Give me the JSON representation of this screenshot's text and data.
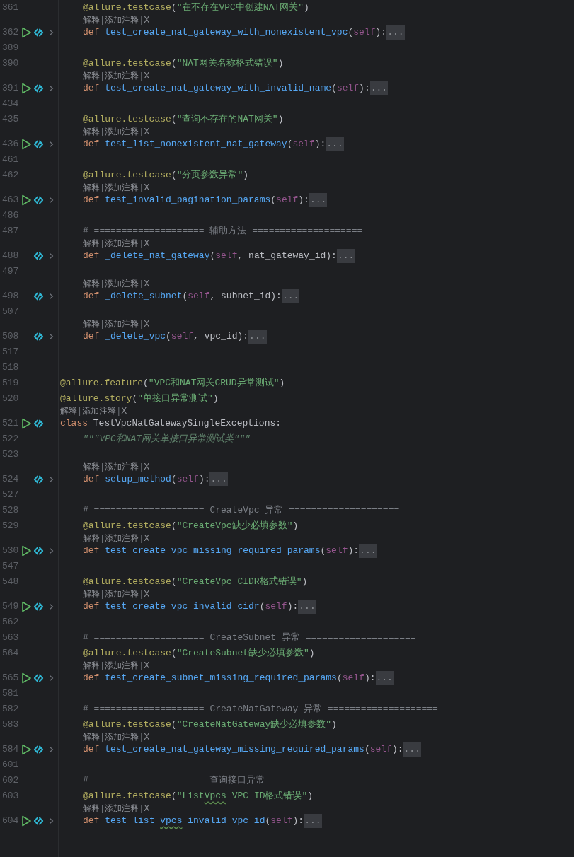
{
  "editor": {
    "lines": [
      {
        "kind": "group",
        "children": [
          {
            "kind": "code",
            "number": "361",
            "run": false,
            "link": false,
            "fold": false,
            "tokens": [
              {
                "kind": "dec",
                "s": "@allure.testcase"
              },
              {
                "kind": "plain",
                "s": "("
              },
              {
                "kind": "str",
                "s": "\"在不存在VPC中创建NAT网关\""
              },
              {
                "kind": "plain",
                "s": ")"
              }
            ]
          },
          {
            "kind": "hint",
            "links": [
              "解释",
              "添加注释",
              "X"
            ],
            "separator": "|"
          },
          {
            "kind": "code",
            "number": "362",
            "run": true,
            "link": true,
            "fold": true,
            "tokens": [
              {
                "kind": "kw",
                "s": "def "
              },
              {
                "kind": "fn",
                "s": "test_create_nat_gateway_with_nonexistent_vpc"
              },
              {
                "kind": "plain",
                "s": "("
              },
              {
                "kind": "self",
                "s": "self"
              },
              {
                "kind": "plain",
                "s": "):"
              }
            ],
            "folded": "..."
          },
          {
            "kind": "code",
            "number": "389",
            "run": false,
            "link": false,
            "fold": false
          },
          {
            "kind": "code",
            "number": "390",
            "run": false,
            "link": false,
            "fold": false,
            "tokens": [
              {
                "kind": "dec",
                "s": "@allure.testcase"
              },
              {
                "kind": "plain",
                "s": "("
              },
              {
                "kind": "str",
                "s": "\"NAT网关名称格式错误\""
              },
              {
                "kind": "plain",
                "s": ")"
              }
            ]
          },
          {
            "kind": "hint",
            "links": [
              "解释",
              "添加注释",
              "X"
            ],
            "separator": "|"
          },
          {
            "kind": "code",
            "number": "391",
            "run": true,
            "link": true,
            "fold": true,
            "tokens": [
              {
                "kind": "kw",
                "s": "def "
              },
              {
                "kind": "fn",
                "s": "test_create_nat_gateway_with_invalid_name"
              },
              {
                "kind": "plain",
                "s": "("
              },
              {
                "kind": "self",
                "s": "self"
              },
              {
                "kind": "plain",
                "s": "):"
              }
            ],
            "folded": "..."
          },
          {
            "kind": "code",
            "number": "434",
            "run": false,
            "link": false,
            "fold": false
          },
          {
            "kind": "code",
            "number": "435",
            "run": false,
            "link": false,
            "fold": false,
            "tokens": [
              {
                "kind": "dec",
                "s": "@allure.testcase"
              },
              {
                "kind": "plain",
                "s": "("
              },
              {
                "kind": "str",
                "s": "\"查询不存在的NAT网关\""
              },
              {
                "kind": "plain",
                "s": ")"
              }
            ]
          },
          {
            "kind": "hint",
            "links": [
              "解释",
              "添加注释",
              "X"
            ],
            "separator": "|"
          },
          {
            "kind": "code",
            "number": "436",
            "run": true,
            "link": true,
            "fold": true,
            "tokens": [
              {
                "kind": "kw",
                "s": "def "
              },
              {
                "kind": "fn",
                "s": "test_list_nonexistent_nat_gateway"
              },
              {
                "kind": "plain",
                "s": "("
              },
              {
                "kind": "self",
                "s": "self"
              },
              {
                "kind": "plain",
                "s": "):"
              }
            ],
            "folded": "..."
          },
          {
            "kind": "code",
            "number": "461",
            "run": false,
            "link": false,
            "fold": false
          },
          {
            "kind": "code",
            "number": "462",
            "run": false,
            "link": false,
            "fold": false,
            "tokens": [
              {
                "kind": "dec",
                "s": "@allure.testcase"
              },
              {
                "kind": "plain",
                "s": "("
              },
              {
                "kind": "str",
                "s": "\"分页参数异常\""
              },
              {
                "kind": "plain",
                "s": ")"
              }
            ]
          },
          {
            "kind": "hint",
            "links": [
              "解释",
              "添加注释",
              "X"
            ],
            "separator": "|"
          },
          {
            "kind": "code",
            "number": "463",
            "run": true,
            "link": true,
            "fold": true,
            "tokens": [
              {
                "kind": "kw",
                "s": "def "
              },
              {
                "kind": "fn",
                "s": "test_invalid_pagination_params"
              },
              {
                "kind": "plain",
                "s": "("
              },
              {
                "kind": "self",
                "s": "self"
              },
              {
                "kind": "plain",
                "s": "):"
              }
            ],
            "folded": "..."
          },
          {
            "kind": "code",
            "number": "486",
            "run": false,
            "link": false,
            "fold": false
          },
          {
            "kind": "code",
            "number": "487",
            "run": false,
            "link": false,
            "fold": false,
            "tokens": [
              {
                "kind": "comment",
                "s": "# ==================== 辅助方法 ===================="
              }
            ]
          },
          {
            "kind": "hint",
            "links": [
              "解释",
              "添加注释",
              "X"
            ],
            "separator": "|"
          },
          {
            "kind": "code",
            "number": "488",
            "run": false,
            "link": true,
            "fold": true,
            "tokens": [
              {
                "kind": "kw",
                "s": "def "
              },
              {
                "kind": "fn",
                "s": "_delete_nat_gateway"
              },
              {
                "kind": "plain",
                "s": "("
              },
              {
                "kind": "self",
                "s": "self"
              },
              {
                "kind": "plain",
                "s": ", nat_gateway_id):"
              }
            ],
            "folded": "..."
          },
          {
            "kind": "code",
            "number": "497",
            "run": false,
            "link": false,
            "fold": false
          },
          {
            "kind": "hint",
            "links": [
              "解释",
              "添加注释",
              "X"
            ],
            "separator": "|"
          },
          {
            "kind": "code",
            "number": "498",
            "run": false,
            "link": true,
            "fold": true,
            "tokens": [
              {
                "kind": "kw",
                "s": "def "
              },
              {
                "kind": "fn",
                "s": "_delete_subnet"
              },
              {
                "kind": "plain",
                "s": "("
              },
              {
                "kind": "self",
                "s": "self"
              },
              {
                "kind": "plain",
                "s": ", subnet_id):"
              }
            ],
            "folded": "..."
          },
          {
            "kind": "code",
            "number": "507",
            "run": false,
            "link": false,
            "fold": false
          },
          {
            "kind": "hint",
            "links": [
              "解释",
              "添加注释",
              "X"
            ],
            "separator": "|"
          },
          {
            "kind": "code",
            "number": "508",
            "run": false,
            "link": true,
            "fold": true,
            "tokens": [
              {
                "kind": "kw",
                "s": "def "
              },
              {
                "kind": "fn",
                "s": "_delete_vpc"
              },
              {
                "kind": "plain",
                "s": "("
              },
              {
                "kind": "self",
                "s": "self"
              },
              {
                "kind": "plain",
                "s": ", vpc_id):"
              }
            ],
            "folded": "..."
          }
        ]
      },
      {
        "kind": "code",
        "number": "517",
        "run": false,
        "link": false,
        "fold": false
      },
      {
        "kind": "code",
        "number": "518",
        "run": false,
        "link": false,
        "fold": false
      },
      {
        "kind": "code",
        "number": "519",
        "run": false,
        "link": false,
        "fold": false,
        "tokens": [
          {
            "kind": "dec",
            "s": "@allure.feature"
          },
          {
            "kind": "plain",
            "s": "("
          },
          {
            "kind": "str",
            "s": "\"VPC和NAT网关CRUD异常测试\""
          },
          {
            "kind": "plain",
            "s": ")"
          }
        ]
      },
      {
        "kind": "code",
        "number": "520",
        "run": false,
        "link": false,
        "fold": false,
        "tokens": [
          {
            "kind": "dec",
            "s": "@allure.story"
          },
          {
            "kind": "plain",
            "s": "("
          },
          {
            "kind": "str",
            "s": "\"单接口异常测试\""
          },
          {
            "kind": "plain",
            "s": ")"
          }
        ]
      },
      {
        "kind": "hint",
        "links": [
          "解释",
          "添加注释",
          "X"
        ],
        "separator": "|"
      },
      {
        "kind": "code",
        "number": "521",
        "run": true,
        "link": true,
        "fold": false,
        "tokens": [
          {
            "kind": "kw",
            "s": "class "
          },
          {
            "kind": "plain",
            "s": "TestVpcNatGatewaySingleExceptions:"
          }
        ],
        "children": [
          {
            "kind": "code",
            "number": "522",
            "run": false,
            "link": false,
            "fold": false,
            "tokens": [
              {
                "kind": "doc",
                "s": "\"\"\"VPC和NAT网关单接口异常测试类\"\"\""
              }
            ]
          },
          {
            "kind": "code",
            "number": "523",
            "run": false,
            "link": false,
            "fold": false
          },
          {
            "kind": "hint",
            "links": [
              "解释",
              "添加注释",
              "X"
            ],
            "separator": "|"
          },
          {
            "kind": "code",
            "number": "524",
            "run": false,
            "link": true,
            "fold": true,
            "tokens": [
              {
                "kind": "kw",
                "s": "def "
              },
              {
                "kind": "fn",
                "s": "setup_method"
              },
              {
                "kind": "plain",
                "s": "("
              },
              {
                "kind": "self",
                "s": "self"
              },
              {
                "kind": "plain",
                "s": "):"
              }
            ],
            "folded": "..."
          },
          {
            "kind": "code",
            "number": "527",
            "run": false,
            "link": false,
            "fold": false
          },
          {
            "kind": "code",
            "number": "528",
            "run": false,
            "link": false,
            "fold": false,
            "tokens": [
              {
                "kind": "comment",
                "s": "# ==================== CreateVpc 异常 ===================="
              }
            ]
          },
          {
            "kind": "code",
            "number": "529",
            "run": false,
            "link": false,
            "fold": false,
            "tokens": [
              {
                "kind": "dec",
                "s": "@allure.testcase"
              },
              {
                "kind": "plain",
                "s": "("
              },
              {
                "kind": "str",
                "s": "\"CreateVpc缺少必填参数\""
              },
              {
                "kind": "plain",
                "s": ")"
              }
            ]
          },
          {
            "kind": "hint",
            "links": [
              "解释",
              "添加注释",
              "X"
            ],
            "separator": "|"
          },
          {
            "kind": "code",
            "number": "530",
            "run": true,
            "link": true,
            "fold": true,
            "tokens": [
              {
                "kind": "kw",
                "s": "def "
              },
              {
                "kind": "fn",
                "s": "test_create_vpc_missing_required_params"
              },
              {
                "kind": "plain",
                "s": "("
              },
              {
                "kind": "self",
                "s": "self"
              },
              {
                "kind": "plain",
                "s": "):"
              }
            ],
            "folded": "..."
          },
          {
            "kind": "code",
            "number": "547",
            "run": false,
            "link": false,
            "fold": false
          },
          {
            "kind": "code",
            "number": "548",
            "run": false,
            "link": false,
            "fold": false,
            "tokens": [
              {
                "kind": "dec",
                "s": "@allure.testcase"
              },
              {
                "kind": "plain",
                "s": "("
              },
              {
                "kind": "str",
                "s": "\"CreateVpc CIDR格式错误\""
              },
              {
                "kind": "plain",
                "s": ")"
              }
            ]
          },
          {
            "kind": "hint",
            "links": [
              "解释",
              "添加注释",
              "X"
            ],
            "separator": "|"
          },
          {
            "kind": "code",
            "number": "549",
            "run": true,
            "link": true,
            "fold": true,
            "tokens": [
              {
                "kind": "kw",
                "s": "def "
              },
              {
                "kind": "fn",
                "s": "test_create_vpc_invalid_cidr"
              },
              {
                "kind": "plain",
                "s": "("
              },
              {
                "kind": "self",
                "s": "self"
              },
              {
                "kind": "plain",
                "s": "):"
              }
            ],
            "folded": "..."
          },
          {
            "kind": "code",
            "number": "562",
            "run": false,
            "link": false,
            "fold": false
          },
          {
            "kind": "code",
            "number": "563",
            "run": false,
            "link": false,
            "fold": false,
            "tokens": [
              {
                "kind": "comment",
                "s": "# ==================== CreateSubnet 异常 ===================="
              }
            ]
          },
          {
            "kind": "code",
            "number": "564",
            "run": false,
            "link": false,
            "fold": false,
            "tokens": [
              {
                "kind": "dec",
                "s": "@allure.testcase"
              },
              {
                "kind": "plain",
                "s": "("
              },
              {
                "kind": "str",
                "s": "\"CreateSubnet缺少必填参数\""
              },
              {
                "kind": "plain",
                "s": ")"
              }
            ]
          },
          {
            "kind": "hint",
            "links": [
              "解释",
              "添加注释",
              "X"
            ],
            "separator": "|"
          },
          {
            "kind": "code",
            "number": "565",
            "run": true,
            "link": true,
            "fold": true,
            "tokens": [
              {
                "kind": "kw",
                "s": "def "
              },
              {
                "kind": "fn",
                "s": "test_create_subnet_missing_required_params"
              },
              {
                "kind": "plain",
                "s": "("
              },
              {
                "kind": "self",
                "s": "self"
              },
              {
                "kind": "plain",
                "s": "):"
              }
            ],
            "folded": "..."
          },
          {
            "kind": "code",
            "number": "581",
            "run": false,
            "link": false,
            "fold": false
          },
          {
            "kind": "code",
            "number": "582",
            "run": false,
            "link": false,
            "fold": false,
            "tokens": [
              {
                "kind": "comment",
                "s": "# ==================== CreateNatGateway 异常 ===================="
              }
            ]
          },
          {
            "kind": "code",
            "number": "583",
            "run": false,
            "link": false,
            "fold": false,
            "tokens": [
              {
                "kind": "dec",
                "s": "@allure.testcase"
              },
              {
                "kind": "plain",
                "s": "("
              },
              {
                "kind": "str",
                "s": "\"CreateNatGateway缺少必填参数\""
              },
              {
                "kind": "plain",
                "s": ")"
              }
            ]
          },
          {
            "kind": "hint",
            "links": [
              "解释",
              "添加注释",
              "X"
            ],
            "separator": "|"
          },
          {
            "kind": "code",
            "number": "584",
            "run": true,
            "link": true,
            "fold": true,
            "tokens": [
              {
                "kind": "kw",
                "s": "def "
              },
              {
                "kind": "fn",
                "s": "test_create_nat_gateway_missing_required_params"
              },
              {
                "kind": "plain",
                "s": "("
              },
              {
                "kind": "self",
                "s": "self"
              },
              {
                "kind": "plain",
                "s": "):"
              }
            ],
            "folded": "..."
          },
          {
            "kind": "code",
            "number": "601",
            "run": false,
            "link": false,
            "fold": false
          },
          {
            "kind": "code",
            "number": "602",
            "run": false,
            "link": false,
            "fold": false,
            "tokens": [
              {
                "kind": "comment",
                "s": "# ==================== 查询接口异常 ===================="
              }
            ]
          },
          {
            "kind": "code",
            "number": "603",
            "run": false,
            "link": false,
            "fold": false,
            "tokens": [
              {
                "kind": "dec",
                "s": "@allure.testcase"
              },
              {
                "kind": "plain",
                "s": "("
              },
              {
                "kind": "str",
                "s": "\"List"
              },
              {
                "kind": "str",
                "s": "Vpcs",
                "squiggle": true
              },
              {
                "kind": "str",
                "s": " VPC ID格式错误\""
              },
              {
                "kind": "plain",
                "s": ")"
              }
            ]
          },
          {
            "kind": "hint",
            "links": [
              "解释",
              "添加注释",
              "X"
            ],
            "separator": "|"
          },
          {
            "kind": "code",
            "number": "604",
            "run": true,
            "link": true,
            "fold": true,
            "tokens": [
              {
                "kind": "kw",
                "s": "def "
              },
              {
                "kind": "fn",
                "s": "test_list_"
              },
              {
                "kind": "fn",
                "s": "vpcs",
                "squiggle": true
              },
              {
                "kind": "fn",
                "s": "_invalid_vpc_id"
              },
              {
                "kind": "plain",
                "s": "("
              },
              {
                "kind": "self",
                "s": "self"
              },
              {
                "kind": "plain",
                "s": "):"
              }
            ],
            "folded": "..."
          }
        ]
      }
    ]
  }
}
